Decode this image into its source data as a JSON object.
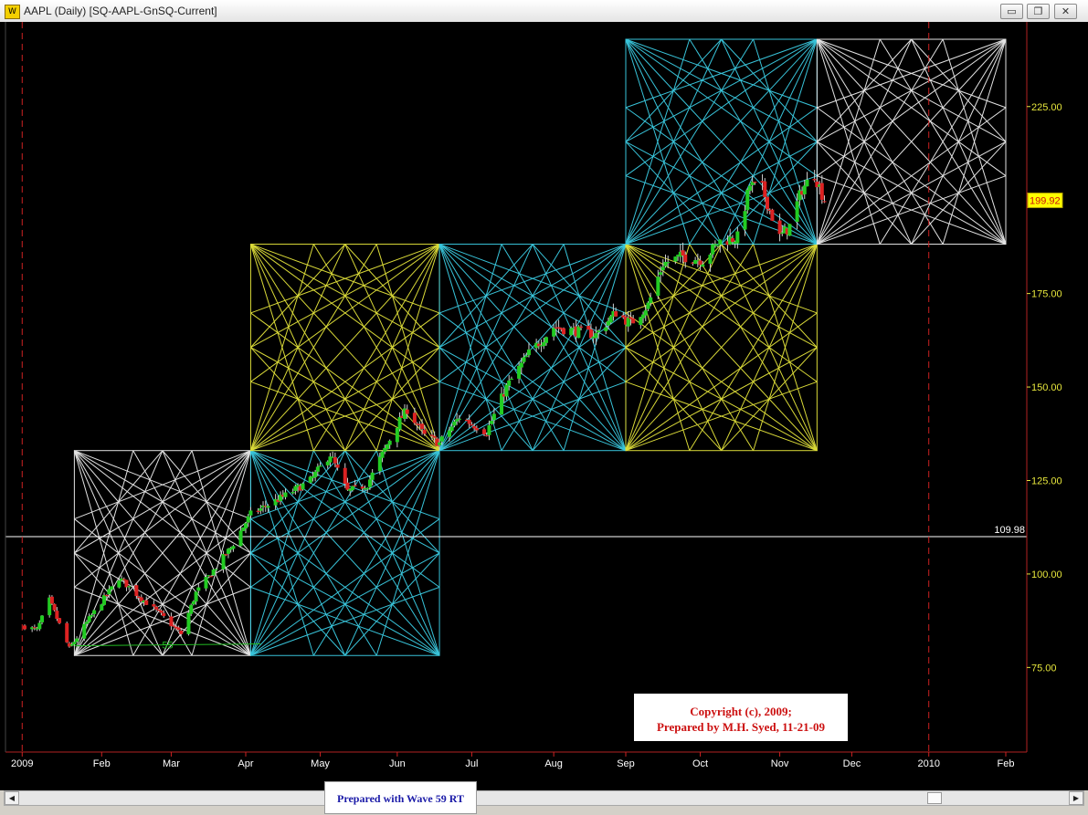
{
  "window": {
    "icon_glyph": "W",
    "title": "AAPL (Daily) [SQ-AAPL-GnSQ-Current]",
    "controls": [
      {
        "name": "minimize-button",
        "glyph": "▭"
      },
      {
        "name": "restore-button",
        "glyph": "❐"
      },
      {
        "name": "close-button",
        "glyph": "✕"
      }
    ]
  },
  "colors": {
    "background": "#000000",
    "up_candle": "#22cc22",
    "down_candle": "#dd2222",
    "square_white": "#f0f0f0",
    "square_yellow": "#e6e63c",
    "square_cyan": "#3ccfe6",
    "axis_labels": "#e6e63c",
    "month_labels": "#ffffff",
    "separator_red": "#cc2222",
    "price_box_text": "#cc1010",
    "price_box_bg": "#ffff00"
  },
  "chart_data": {
    "type": "candlestick",
    "symbol": "AAPL",
    "interval": "Daily",
    "x_labels": [
      "2009",
      "Feb",
      "Mar",
      "Apr",
      "May",
      "Jun",
      "Jul",
      "Aug",
      "Sep",
      "Oct",
      "Nov",
      "Dec",
      "2010",
      "Feb"
    ],
    "y_ticks": [
      "225.00",
      "175.00",
      "150.00",
      "125.00",
      "100.00",
      "75.00"
    ],
    "y_tick_values": [
      225,
      175,
      150,
      125,
      100,
      75
    ],
    "ylim": [
      66.3,
      245.2
    ],
    "last_price": "199.92",
    "last_price_value": 199.92,
    "horizontal_line": "109.98",
    "horizontal_line_value": 109.98,
    "year_separators": [
      "2009",
      "2010"
    ],
    "annotation": "55",
    "gann_squares": [
      {
        "color": "white",
        "from": "Jan 22 2009",
        "to": "Apr 3 2009",
        "low": 78.2,
        "high": 133.0
      },
      {
        "color": "cyan",
        "from": "Apr 3 2009",
        "to": "Jun 18 2009",
        "low": 78.2,
        "high": 133.0
      },
      {
        "color": "yellow",
        "from": "Apr 3 2009",
        "to": "Jun 18 2009",
        "low": 133.0,
        "high": 188.2
      },
      {
        "color": "cyan",
        "from": "Jun 18 2009",
        "to": "Sep 1 2009",
        "low": 133.0,
        "high": 188.2
      },
      {
        "color": "yellow",
        "from": "Sep 1 2009",
        "to": "Nov 17 2009",
        "low": 133.0,
        "high": 188.2
      },
      {
        "color": "cyan",
        "from": "Sep 1 2009",
        "to": "Nov 17 2009",
        "low": 188.2,
        "high": 243.0
      },
      {
        "color": "white",
        "from": "Nov 17 2009",
        "to": "Feb 1 2010",
        "low": 188.2,
        "high": 243.0
      }
    ],
    "price_anchors": [
      [
        "Jan 2 2009",
        86
      ],
      [
        "Jan 7 2009",
        85
      ],
      [
        "Jan 12 2009",
        93
      ],
      [
        "Jan 20 2009",
        80
      ],
      [
        "Jan 28 2009",
        88
      ],
      [
        "Feb 9 2009",
        99
      ],
      [
        "Feb 17 2009",
        94
      ],
      [
        "Feb 26 2009",
        89
      ],
      [
        "Mar 6 2009",
        84
      ],
      [
        "Mar 12 2009",
        95
      ],
      [
        "Mar 26 2009",
        107
      ],
      [
        "Apr 3 2009",
        116
      ],
      [
        "Apr 17 2009",
        121
      ],
      [
        "Apr 27 2009",
        125
      ],
      [
        "May 5 2009",
        132
      ],
      [
        "May 12 2009",
        122
      ],
      [
        "May 20 2009",
        124
      ],
      [
        "Jun 1 2009",
        140
      ],
      [
        "Jun 5 2009",
        144
      ],
      [
        "Jun 12 2009",
        137
      ],
      [
        "Jun 18 2009",
        135
      ],
      [
        "Jun 26 2009",
        142
      ],
      [
        "Jul 7 2009",
        138
      ],
      [
        "Jul 15 2009",
        150
      ],
      [
        "Jul 24 2009",
        159
      ],
      [
        "Aug 3 2009",
        166
      ],
      [
        "Aug 12 2009",
        165
      ],
      [
        "Aug 20 2009",
        164
      ],
      [
        "Aug 28 2009",
        170
      ],
      [
        "Sep 3 2009",
        167
      ],
      [
        "Sep 10 2009",
        172
      ],
      [
        "Sep 16 2009",
        183
      ],
      [
        "Sep 24 2009",
        185
      ],
      [
        "Oct 2 2009",
        184
      ],
      [
        "Oct 9 2009",
        189
      ],
      [
        "Oct 16 2009",
        190
      ],
      [
        "Oct 21 2009",
        204
      ],
      [
        "Oct 26 2009",
        203
      ],
      [
        "Nov 2 2009",
        190
      ],
      [
        "Nov 6 2009",
        193
      ],
      [
        "Nov 11 2009",
        203
      ],
      [
        "Nov 16 2009",
        207
      ],
      [
        "Nov 20 2009",
        200
      ]
    ],
    "grid": false
  },
  "footer": {
    "wave59": "Prepared with Wave 59 RT",
    "copyright_line1": "Copyright (c), 2009;",
    "copyright_line2": "Prepared by M.H. Syed, 11-21-09"
  }
}
